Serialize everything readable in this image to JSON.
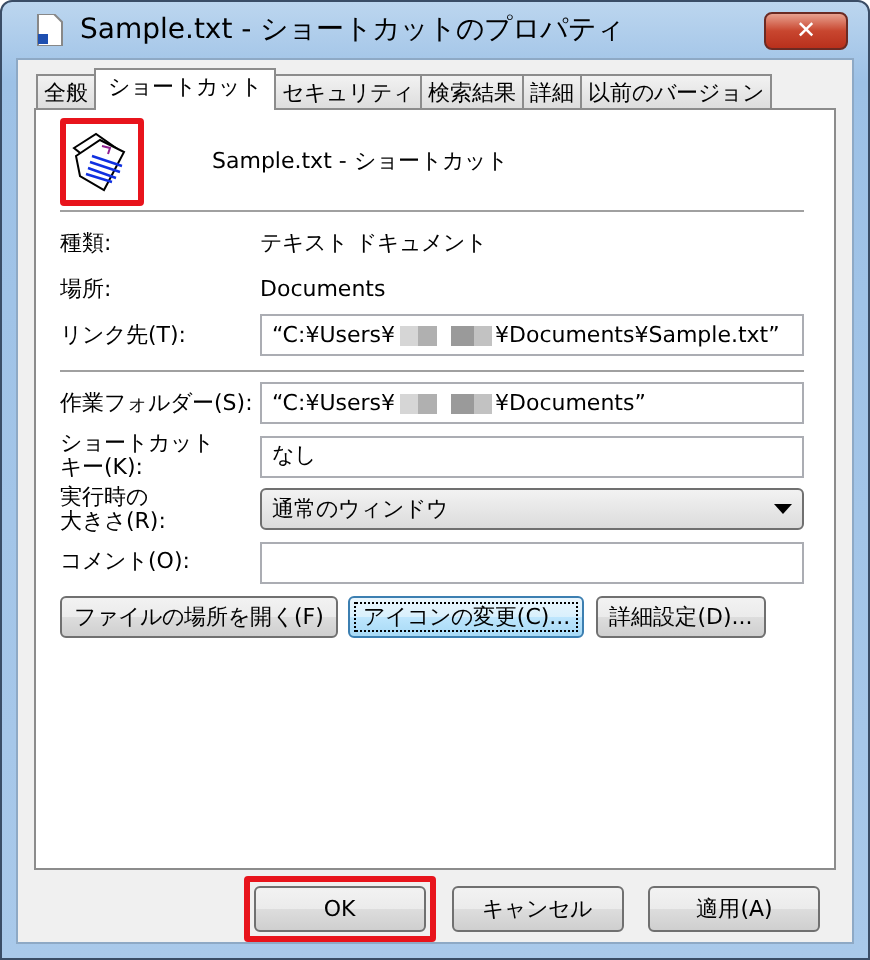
{
  "window": {
    "title": "Sample.txt - ショートカットのプロパティ",
    "close": "✕"
  },
  "tabs": [
    {
      "label": "全般",
      "selected": false
    },
    {
      "label": "ショートカット",
      "selected": true
    },
    {
      "label": "セキュリティ",
      "selected": false
    },
    {
      "label": "検索結果",
      "selected": false
    },
    {
      "label": "詳細",
      "selected": false
    },
    {
      "label": "以前のバージョン",
      "selected": false
    }
  ],
  "header": {
    "name": "Sample.txt - ショートカット",
    "highlighted": true
  },
  "info": [
    {
      "label": "種類:",
      "value": "テキスト ドキュメント"
    },
    {
      "label": "場所:",
      "value": "Documents"
    }
  ],
  "target": {
    "label": "リンク先(T):",
    "value_parts": [
      "“C:¥Users¥",
      "¥Documents¥Sample.txt”"
    ],
    "redacted": true
  },
  "settings": [
    {
      "kind": "field",
      "label": [
        "作業フォルダー(S):"
      ],
      "value_parts": [
        "“C:¥Users¥",
        "¥Documents”"
      ],
      "redacted": true
    },
    {
      "kind": "field",
      "label": [
        "ショートカット",
        "キー(K):"
      ],
      "value_parts": [
        "なし"
      ]
    },
    {
      "kind": "select",
      "label": [
        "実行時の",
        "大きさ(R):"
      ],
      "value_parts": [
        "通常のウィンドウ"
      ]
    },
    {
      "kind": "field",
      "label": [
        "コメント(O):"
      ]
    }
  ],
  "action_buttons": [
    {
      "label": "ファイルの場所を開く(F)",
      "focused": false
    },
    {
      "label": "アイコンの変更(C)...",
      "focused": true
    },
    {
      "label": "詳細設定(D)...",
      "focused": false
    }
  ],
  "dialog_buttons": [
    {
      "label": "OK",
      "highlighted": true
    },
    {
      "label": "キャンセル",
      "highlighted": false
    },
    {
      "label": "適用(A)",
      "highlighted": false
    }
  ]
}
